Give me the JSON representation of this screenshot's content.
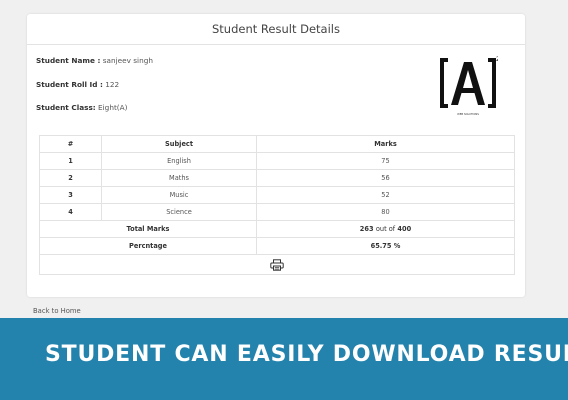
{
  "card": {
    "title": "Student Result Details"
  },
  "student": {
    "name_label": "Student Name :",
    "name": "sanjeev singh",
    "roll_label": "Student Roll Id :",
    "roll": "122",
    "class_label": "Student Class:",
    "class": "Eight(A)"
  },
  "logo": {
    "text": "[A]",
    "superscript": "2",
    "tagline": "WEB SOLUTIONS"
  },
  "table": {
    "headers": [
      "#",
      "Subject",
      "Marks"
    ],
    "rows": [
      {
        "num": "1",
        "subject": "English",
        "marks": "75"
      },
      {
        "num": "2",
        "subject": "Maths",
        "marks": "56"
      },
      {
        "num": "3",
        "subject": "Music",
        "marks": "52"
      },
      {
        "num": "4",
        "subject": "Science",
        "marks": "80"
      }
    ],
    "total_label": "Total Marks",
    "total_score": "263",
    "total_sep": "out of",
    "total_max": "400",
    "percentage_label": "Percntage",
    "percentage_value": "65.75 %"
  },
  "print_icon": "printer-icon",
  "nav": {
    "back_label": "Back to Home"
  },
  "banner": {
    "text": "STUDENT CAN EASILY DOWNLOAD RESULT"
  },
  "colors": {
    "banner": "#2383ad",
    "page_bg": "#f0f0f0"
  }
}
